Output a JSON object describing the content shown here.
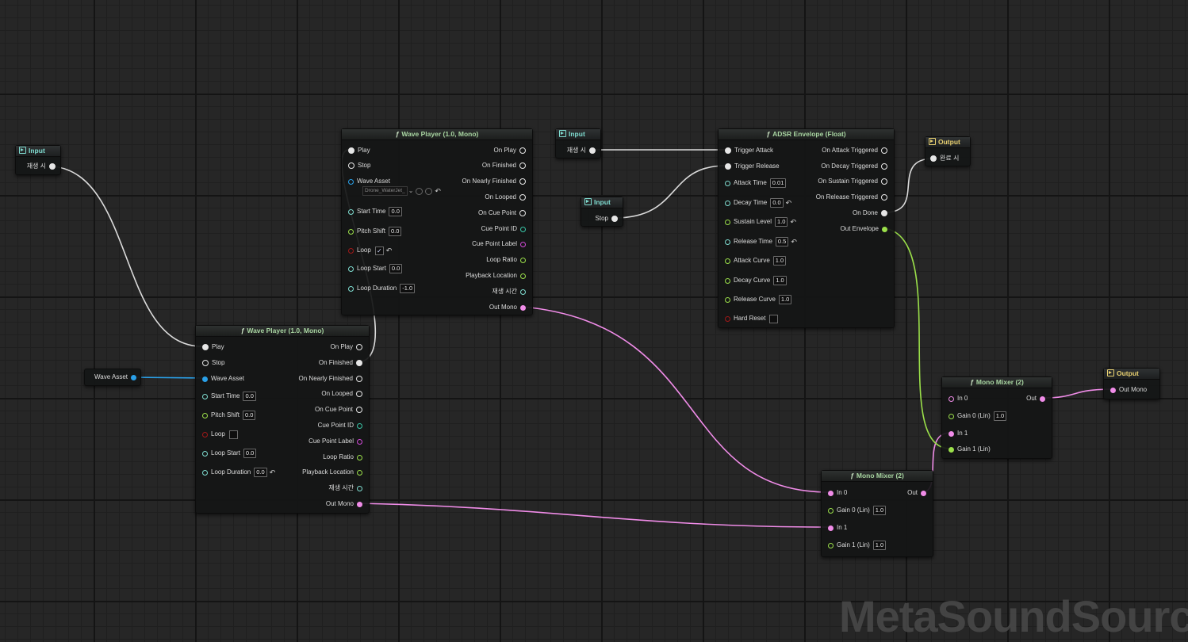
{
  "graph_type_label": "MetaSoundSourc",
  "colors": {
    "exec": "#e6e6e6",
    "audio": "#f08ce8",
    "float": "#9be04a",
    "time": "#7fdcd0",
    "bool": "#a01818",
    "asset": "#2aa0e8",
    "string": "#d24ad8",
    "wire_white": "#dcdcdc"
  },
  "nodes": {
    "input_play": {
      "header": "Input",
      "pin": "재생 시"
    },
    "input_play2": {
      "header": "Input",
      "pin": "재생 시"
    },
    "input_stop": {
      "header": "Input",
      "pin": "Stop"
    },
    "input_wave_asset": {
      "pin": "Wave Asset"
    },
    "output_done": {
      "header": "Output",
      "pin": "완료 시"
    },
    "output_mono": {
      "header": "Output",
      "pin": "Out Mono"
    },
    "wave_player_top": {
      "title": "Wave Player (1.0, Mono)",
      "inputs": {
        "play": "Play",
        "stop": "Stop",
        "wave_asset": "Wave Asset",
        "asset_value": "Drone_WaterJet_",
        "start_time": "Start Time",
        "start_time_val": "0.0",
        "pitch_shift": "Pitch Shift",
        "pitch_shift_val": "0.0",
        "loop": "Loop",
        "loop_start": "Loop Start",
        "loop_start_val": "0.0",
        "loop_duration": "Loop Duration",
        "loop_duration_val": "-1.0"
      },
      "outputs": {
        "on_play": "On Play",
        "on_finished": "On Finished",
        "on_nearly_finished": "On Nearly Finished",
        "on_looped": "On Looped",
        "on_cue_point": "On Cue Point",
        "cue_point_id": "Cue Point ID",
        "cue_point_label": "Cue Point Label",
        "loop_ratio": "Loop Ratio",
        "playback_location": "Playback Location",
        "play_time": "재생 시간",
        "out_mono": "Out Mono"
      }
    },
    "wave_player_bottom": {
      "title": "Wave Player (1.0, Mono)",
      "inputs": {
        "play": "Play",
        "stop": "Stop",
        "wave_asset": "Wave Asset",
        "start_time": "Start Time",
        "start_time_val": "0.0",
        "pitch_shift": "Pitch Shift",
        "pitch_shift_val": "0.0",
        "loop": "Loop",
        "loop_start": "Loop Start",
        "loop_start_val": "0.0",
        "loop_duration": "Loop Duration",
        "loop_duration_val": "0.0"
      },
      "outputs": {
        "on_play": "On Play",
        "on_finished": "On Finished",
        "on_nearly_finished": "On Nearly Finished",
        "on_looped": "On Looped",
        "on_cue_point": "On Cue Point",
        "cue_point_id": "Cue Point ID",
        "cue_point_label": "Cue Point Label",
        "loop_ratio": "Loop Ratio",
        "playback_location": "Playback Location",
        "play_time": "재생 시간",
        "out_mono": "Out Mono"
      }
    },
    "adsr": {
      "title": "ADSR Envelope (Float)",
      "inputs": {
        "trigger_attack": "Trigger Attack",
        "trigger_release": "Trigger Release",
        "attack_time": "Attack Time",
        "attack_time_val": "0.01",
        "decay_time": "Decay Time",
        "decay_time_val": "0.0",
        "sustain_level": "Sustain Level",
        "sustain_level_val": "1.0",
        "release_time": "Release Time",
        "release_time_val": "0.5",
        "attack_curve": "Attack Curve",
        "attack_curve_val": "1.0",
        "decay_curve": "Decay Curve",
        "decay_curve_val": "1.0",
        "release_curve": "Release Curve",
        "release_curve_val": "1.0",
        "hard_reset": "Hard Reset"
      },
      "outputs": {
        "on_attack_triggered": "On Attack Triggered",
        "on_decay_triggered": "On Decay Triggered",
        "on_sustain_triggered": "On Sustain Triggered",
        "on_release_triggered": "On Release Triggered",
        "on_done": "On Done",
        "out_envelope": "Out Envelope"
      }
    },
    "mixer_bottom": {
      "title": "Mono Mixer (2)",
      "in0": "In 0",
      "gain0": "Gain 0 (Lin)",
      "gain0_val": "1.0",
      "in1": "In 1",
      "gain1": "Gain 1 (Lin)",
      "gain1_val": "1.0",
      "out": "Out"
    },
    "mixer_right": {
      "title": "Mono Mixer (2)",
      "in0": "In 0",
      "gain0": "Gain 0 (Lin)",
      "gain0_val": "1.0",
      "in1": "In 1",
      "gain1": "Gain 1 (Lin)",
      "out": "Out"
    }
  }
}
